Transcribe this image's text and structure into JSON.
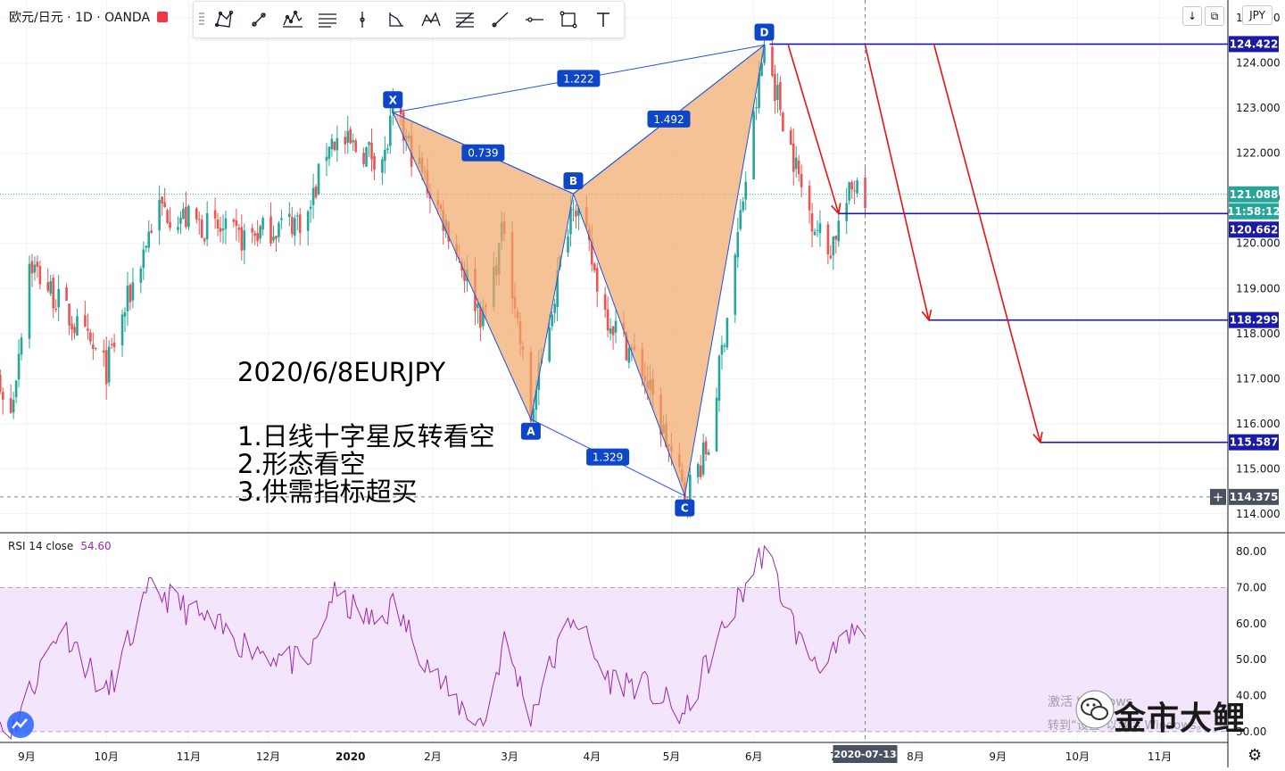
{
  "header": {
    "symbol": "欧元/日元 · 1D · OANDA",
    "currency": "JPY"
  },
  "toolbar": {
    "tools": [
      "xabcd-pattern-icon",
      "trend-line-icon",
      "elliott-wave-icon",
      "parallel-channel-icon",
      "vertical-line-icon",
      "abcd-pattern-icon",
      "head-shoulders-icon",
      "fib-retracement-icon",
      "ray-icon",
      "horizontal-line-icon",
      "rectangle-icon",
      "text-tool-icon"
    ]
  },
  "top_buttons": {
    "down": "↓",
    "restore": "⧉"
  },
  "notes": {
    "title": "2020/6/8EURJPY",
    "line1": "1.日线十字星反转看空",
    "line2": "2.形态看空",
    "line3": "3.供需指标超买"
  },
  "watermark": {
    "brand": "金市大鲤",
    "sub1": "激活 Windows",
    "sub2": "转到“设置”以激活 Windows。"
  },
  "colors": {
    "up": "#26a69a",
    "down": "#ef5350",
    "pattern_fill": "#f0a868",
    "pattern_line": "#1e53e5",
    "marker": "#0d47c7",
    "target_line": "#1a1aa6",
    "arrow": "#e8120e",
    "rsi": "#9c27b0",
    "rsi_band": "#f3e5fb"
  },
  "chart_data": [
    {
      "type": "candlestick",
      "title": "欧元/日元 · 1D · OANDA",
      "ylabel": "JPY",
      "ylim": [
        113.6,
        125.4
      ],
      "x_tick_labels": [
        "9月",
        "10月",
        "11月",
        "12月",
        "2020",
        "2月",
        "3月",
        "4月",
        "5月",
        "6月",
        "7",
        "8月",
        "9月",
        "10月",
        "11月"
      ],
      "y_tick_labels": [
        "114.000",
        "115.000",
        "116.000",
        "117.000",
        "118.000",
        "119.000",
        "120.000",
        "121.000",
        "122.000",
        "123.000",
        "124.000",
        "125.000"
      ],
      "cursor_date": "2020-07-13",
      "path_anchors": [
        {
          "date": "2019-08-12",
          "price": 118.4
        },
        {
          "date": "2019-08-26",
          "price": 116.2
        },
        {
          "date": "2019-09-02",
          "price": 119.6
        },
        {
          "date": "2019-10-01",
          "price": 117.2
        },
        {
          "date": "2019-10-20",
          "price": 120.8
        },
        {
          "date": "2019-11-20",
          "price": 120.1
        },
        {
          "date": "2019-12-16",
          "price": 120.6
        },
        {
          "date": "2019-12-24",
          "price": 122.3
        },
        {
          "date": "2020-01-14",
          "price": 121.9
        },
        {
          "date": "2020-01-17",
          "price": 122.9
        },
        {
          "date": "2020-02-07",
          "price": 120.3
        },
        {
          "date": "2020-02-20",
          "price": 118.3
        },
        {
          "date": "2020-02-28",
          "price": 120.4
        },
        {
          "date": "2020-03-09",
          "price": 116.1
        },
        {
          "date": "2020-03-25",
          "price": 121.1
        },
        {
          "date": "2020-04-06",
          "price": 118.5
        },
        {
          "date": "2020-04-20",
          "price": 117.2
        },
        {
          "date": "2020-05-06",
          "price": 114.4
        },
        {
          "date": "2020-05-15",
          "price": 115.5
        },
        {
          "date": "2020-06-05",
          "price": 124.4
        },
        {
          "date": "2020-06-20",
          "price": 121.0
        },
        {
          "date": "2020-06-29",
          "price": 119.8
        },
        {
          "date": "2020-07-10",
          "price": 121.5
        },
        {
          "date": "2020-07-13",
          "price": 121.1
        }
      ],
      "pattern_points": [
        {
          "label": "X",
          "date": "2020-01-17",
          "price": 122.9
        },
        {
          "label": "A",
          "date": "2020-03-09",
          "price": 116.1
        },
        {
          "label": "B",
          "date": "2020-03-25",
          "price": 121.1
        },
        {
          "label": "C",
          "date": "2020-05-06",
          "price": 114.4
        },
        {
          "label": "D",
          "date": "2020-06-05",
          "price": 124.4
        }
      ],
      "pattern_ratios": {
        "XB": "0.739",
        "AC": "1.329",
        "BD": "1.492",
        "XD": "1.222"
      },
      "horizontal_levels": [
        124.422,
        120.662,
        118.299,
        115.587
      ],
      "price_labels": [
        {
          "text": "124.422",
          "value": 124.422,
          "style": "target"
        },
        {
          "text": "121.088",
          "value": 121.088,
          "style": "last"
        },
        {
          "text": "11:58:12",
          "value": 120.8,
          "style": "last"
        },
        {
          "text": "120.662",
          "value": 120.662,
          "style": "target"
        },
        {
          "text": "118.299",
          "value": 118.299,
          "style": "target"
        },
        {
          "text": "115.587",
          "value": 115.587,
          "style": "target"
        },
        {
          "text": "114.375",
          "value": 114.375,
          "style": "cursor"
        }
      ],
      "last_price": 121.088,
      "cursor_price": 114.375,
      "arrows": [
        {
          "from": {
            "date": "2020-06-14",
            "price": 124.4
          },
          "to": {
            "date": "2020-07-03",
            "price": 120.662
          }
        },
        {
          "from": {
            "date": "2020-07-13",
            "price": 124.4
          },
          "to": {
            "date": "2020-08-06",
            "price": 118.299
          }
        },
        {
          "from": {
            "date": "2020-08-08",
            "price": 124.4
          },
          "to": {
            "date": "2020-09-17",
            "price": 115.587
          }
        }
      ]
    },
    {
      "type": "line",
      "title": "RSI 14 close",
      "series": [
        {
          "name": "RSI 14 close",
          "last": "54.60"
        }
      ],
      "ylim": [
        27,
        85
      ],
      "band": [
        30,
        70
      ],
      "y_tick_labels": [
        "30.00",
        "40.00",
        "50.00",
        "60.00",
        "70.00",
        "80.00"
      ],
      "path_anchors": [
        {
          "date": "2019-08-12",
          "value": 40
        },
        {
          "date": "2019-08-26",
          "value": 30
        },
        {
          "date": "2019-09-14",
          "value": 60
        },
        {
          "date": "2019-10-01",
          "value": 40
        },
        {
          "date": "2019-10-18",
          "value": 70
        },
        {
          "date": "2019-11-20",
          "value": 55
        },
        {
          "date": "2019-12-16",
          "value": 48
        },
        {
          "date": "2019-12-25",
          "value": 68
        },
        {
          "date": "2020-01-10",
          "value": 60
        },
        {
          "date": "2020-01-17",
          "value": 65
        },
        {
          "date": "2020-02-07",
          "value": 40
        },
        {
          "date": "2020-02-20",
          "value": 32
        },
        {
          "date": "2020-02-28",
          "value": 55
        },
        {
          "date": "2020-03-09",
          "value": 35
        },
        {
          "date": "2020-03-25",
          "value": 63
        },
        {
          "date": "2020-04-06",
          "value": 45
        },
        {
          "date": "2020-04-20",
          "value": 43
        },
        {
          "date": "2020-05-06",
          "value": 34
        },
        {
          "date": "2020-05-15",
          "value": 50
        },
        {
          "date": "2020-06-05",
          "value": 81
        },
        {
          "date": "2020-06-20",
          "value": 52
        },
        {
          "date": "2020-06-29",
          "value": 49
        },
        {
          "date": "2020-07-10",
          "value": 58
        },
        {
          "date": "2020-07-13",
          "value": 54.6
        }
      ]
    }
  ]
}
